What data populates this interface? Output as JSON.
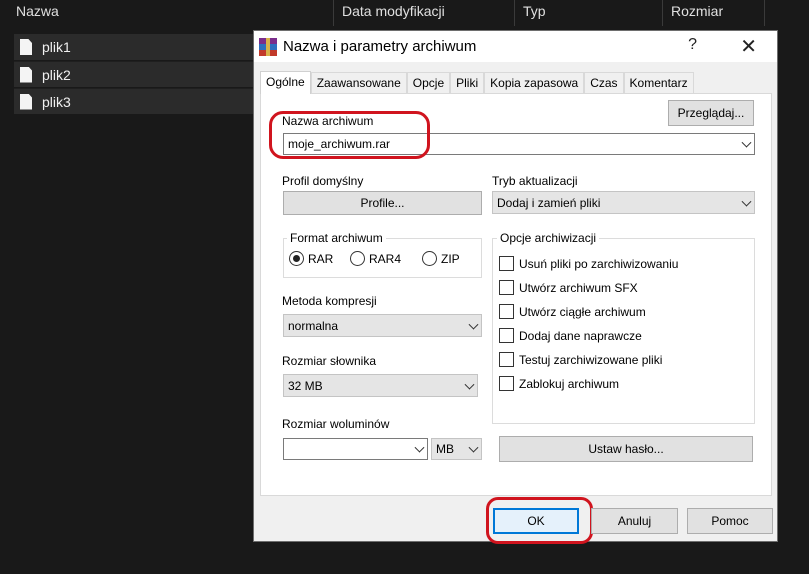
{
  "explorer": {
    "columns": [
      "Nazwa",
      "Data modyfikacji",
      "Typ",
      "Rozmiar"
    ],
    "files": [
      "plik1",
      "plik2",
      "plik3"
    ]
  },
  "dialog": {
    "title": "Nazwa i parametry archiwum",
    "help": "?",
    "close": "✕",
    "tabs": [
      "Ogólne",
      "Zaawansowane",
      "Opcje",
      "Pliki",
      "Kopia zapasowa",
      "Czas",
      "Komentarz"
    ],
    "active_tab": "Ogólne",
    "archive_name_label": "Nazwa archiwum",
    "archive_name_value": "moje_archiwum.rar",
    "browse_button": "Przeglądaj...",
    "default_profile_label": "Profil domyślny",
    "profiles_button": "Profile...",
    "update_mode_label": "Tryb aktualizacji",
    "update_mode_value": "Dodaj i zamień pliki",
    "format_group": "Format archiwum",
    "formats": [
      "RAR",
      "RAR4",
      "ZIP"
    ],
    "selected_format": "RAR",
    "compression_label": "Metoda kompresji",
    "compression_value": "normalna",
    "dictionary_label": "Rozmiar słownika",
    "dictionary_value": "32 MB",
    "volume_label": "Rozmiar woluminów",
    "volume_value": "",
    "volume_unit": "MB",
    "password_button": "Ustaw hasło...",
    "options_group": "Opcje archiwizacji",
    "options": [
      "Usuń pliki po zarchiwizowaniu",
      "Utwórz archiwum SFX",
      "Utwórz ciągłe archiwum",
      "Dodaj dane naprawcze",
      "Testuj zarchiwizowane pliki",
      "Zablokuj archiwum"
    ],
    "ok_button": "OK",
    "cancel_button": "Anuluj",
    "help_button": "Pomoc",
    "highlight_color": "#d0141e"
  }
}
